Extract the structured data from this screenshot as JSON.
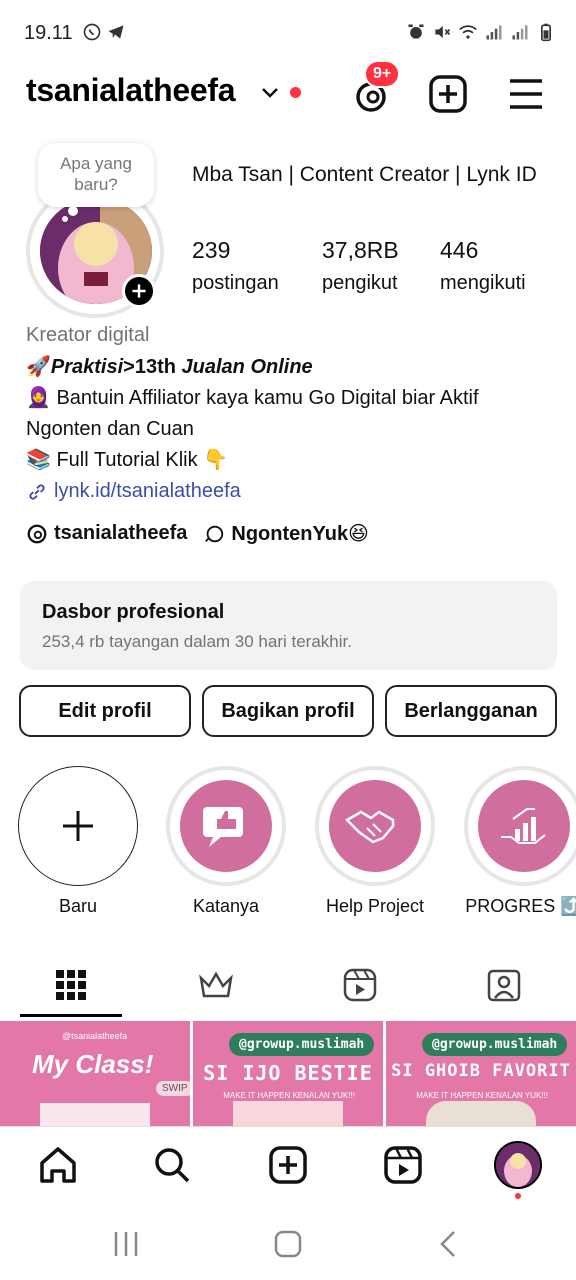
{
  "status_bar": {
    "time": "19.11",
    "left_icons": [
      "whatsapp-icon",
      "telegram-icon"
    ],
    "right_icons": [
      "alarm-icon",
      "mute-icon",
      "wifi-icon",
      "signal-icon",
      "signal-icon",
      "battery-icon"
    ]
  },
  "header": {
    "username": "tsanialatheefa",
    "notification_badge": "9+"
  },
  "profile": {
    "note": "Apa yang baru?",
    "display_name": "Mba Tsan | Content Creator | Lynk ID",
    "stats": [
      {
        "value": "239",
        "label": "postingan"
      },
      {
        "value": "37,8RB",
        "label": "pengikut"
      },
      {
        "value": "446",
        "label": "mengikuti"
      }
    ],
    "category": "Kreator digital",
    "bio_line1_prefix": "🚀",
    "bio_line1_italic": "Praktisi",
    "bio_line1_rest": ">13th ",
    "bio_line1_italic2": "Jualan Online",
    "bio_line2": "🧕 Bantuin Affiliator kaya kamu Go Digital biar Aktif Ngonten dan Cuan",
    "bio_line3": "📚 Full Tutorial Klik 👇",
    "link": "lynk.id/tsanialatheefa",
    "threads_handle": "tsanialatheefa",
    "channel_name": "NgontenYuk😆"
  },
  "dashboard": {
    "title": "Dasbor profesional",
    "subtitle": "253,4 rb tayangan dalam 30 hari terakhir."
  },
  "buttons": {
    "edit": "Edit profil",
    "share": "Bagikan profil",
    "subscribe": "Berlangganan"
  },
  "highlights": [
    {
      "label": "Baru"
    },
    {
      "label": "Katanya"
    },
    {
      "label": "Help Project"
    },
    {
      "label": "PROGRES ⤴️"
    }
  ],
  "grid_posts": [
    {
      "handle": "@tsanialatheefa",
      "title": "My Class!",
      "tag": "SWIP"
    },
    {
      "handle": "@growup.muslimah",
      "title": "SI IJO BESTIE",
      "tag": "MAKE IT HAPPEN KENALAN YUK!!!"
    },
    {
      "handle": "@growup.muslimah",
      "title": "SI GHOIB FAVORIT",
      "tag": "MAKE IT HAPPEN KENALAN YUK!!!"
    }
  ],
  "colors": {
    "accent_red": "#ff3040",
    "link_blue": "#3b4da8",
    "highlight_pink": "#d06e9e",
    "muted_gray": "#737373"
  }
}
